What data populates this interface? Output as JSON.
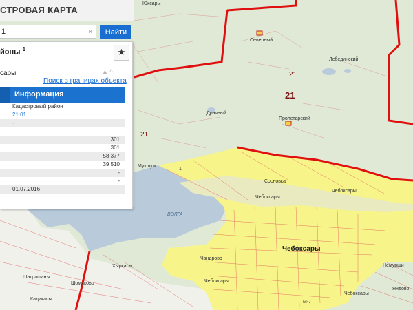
{
  "header": {
    "title": "СТРОВАЯ КАРТА"
  },
  "search": {
    "value": "1",
    "clear_glyph": "×",
    "button_label": "Найти"
  },
  "panel": {
    "layer_title": "йоны",
    "layer_sup": "1",
    "star_glyph": "★",
    "object_name": "сары",
    "search_link": "Поиск в границах объекта →",
    "info_header": "Информация",
    "rows": [
      {
        "label": "Кадастровый район",
        "value": "",
        "shade": false,
        "link": false
      },
      {
        "label": "21:01",
        "value": "",
        "shade": false,
        "link": true
      },
      {
        "label": "-",
        "value": "",
        "shade": true,
        "link": false
      },
      {
        "label": "",
        "value": "",
        "shade": false,
        "link": false
      },
      {
        "label": "",
        "value": "301",
        "shade": true,
        "link": false
      },
      {
        "label": "",
        "value": "301",
        "shade": false,
        "link": false
      },
      {
        "label": "",
        "value": "58 377",
        "shade": true,
        "link": false
      },
      {
        "label": "",
        "value": "39 510",
        "shade": false,
        "link": false
      },
      {
        "label": "",
        "value": "-",
        "shade": true,
        "link": false
      },
      {
        "label": "",
        "value": "-",
        "shade": false,
        "link": false
      },
      {
        "label": "01.07.2016",
        "value": "",
        "shade": true,
        "link": false
      }
    ]
  },
  "map": {
    "labels": {
      "severny": "Северный",
      "lebedinsky": "Лебединский",
      "drachny": "Драчный",
      "proletarsky": "Пролетарский",
      "mukshum": "Мукшум",
      "sosnovka": "Сосновка",
      "cheb1": "Чебоксары",
      "cheb2": "Чебоксары",
      "cheb_city": "Чебоксары",
      "cheb3": "Чебоксары",
      "cheb4": "Чебоксары",
      "chandrovo": "Чандрово",
      "khyrkasy": "Хыркасы",
      "shomikovo": "Шомиково",
      "shatrashany": "Шатрашаны",
      "kadikasy": "Кадикасы",
      "yukasy": "Юксары",
      "yandovo": "Яндово",
      "nemurshi": "Немурши",
      "volga": "ВОЛГА",
      "m7": "М-7",
      "r21a": "21",
      "r21b": "21",
      "r21c": "21",
      "r1": "1"
    },
    "colors": {
      "forest": "#dfe9d6",
      "urban": "#f7f48a",
      "water": "#b9cbdb",
      "border": "#e01010",
      "parcel": "#e05a5a"
    }
  }
}
